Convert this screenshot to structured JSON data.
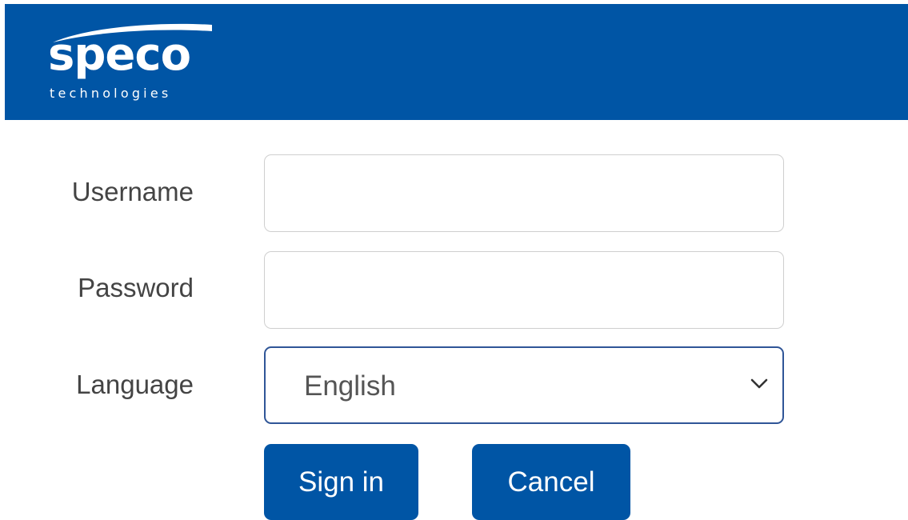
{
  "brand": {
    "name": "speco",
    "tagline": "technologies",
    "color": "#0055a5",
    "logo_icon": "speco-logo"
  },
  "form": {
    "username_label": "Username",
    "username_value": "",
    "password_label": "Password",
    "password_value": "",
    "language_label": "Language",
    "language_value": "English",
    "language_icon": "chevron-down-icon"
  },
  "buttons": {
    "sign_in": "Sign in",
    "cancel": "Cancel"
  }
}
